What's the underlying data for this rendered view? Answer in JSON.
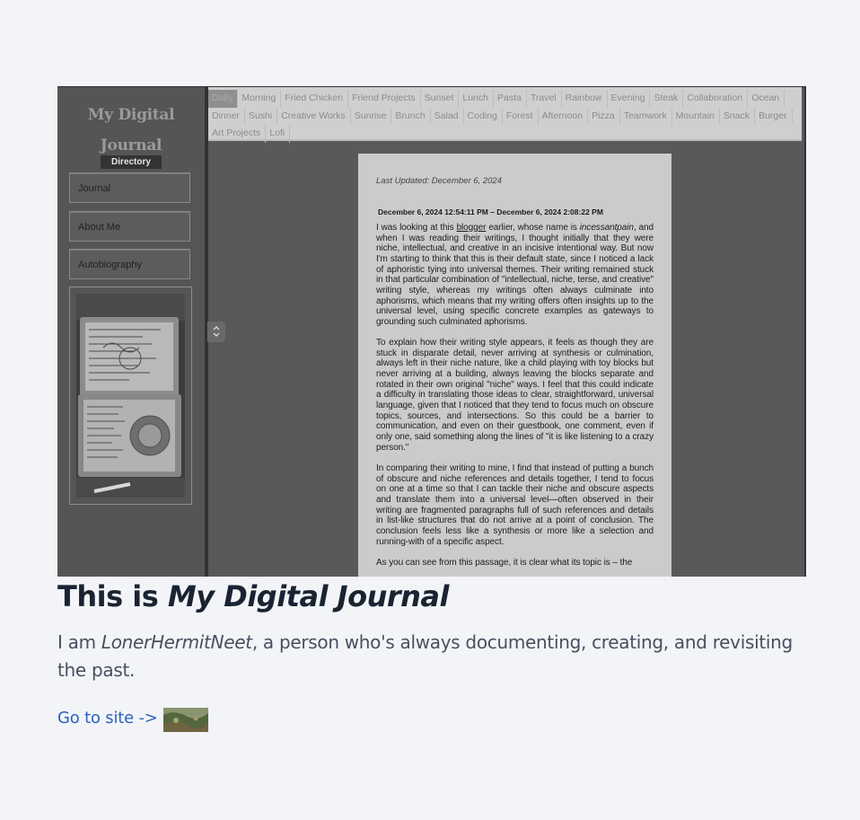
{
  "site": {
    "title_line1": "My Digital",
    "title_line2": "Journal",
    "directory_label": "Directory",
    "nav": [
      "Journal",
      "About Me",
      "Autobiography"
    ],
    "tags": [
      "Daily",
      "Morning",
      "Fried Chicken",
      "Friend Projects",
      "Sunset",
      "Lunch",
      "Pasta",
      "Travel",
      "Rainbow",
      "Evening",
      "Steak",
      "Collaboration",
      "Ocean",
      "Dinner",
      "Sushi",
      "Creative Works",
      "Sunrise",
      "Brunch",
      "Salad",
      "Coding",
      "Forest",
      "Afternoon",
      "Pizza",
      "Teamwork",
      "Mountain",
      "Snack",
      "Burger",
      "Art Projects",
      "Lofi"
    ],
    "toggle_icon": "updown-chevron-icon",
    "page": {
      "last_updated": "Last Updated: December 6, 2024",
      "date_range": "December 6, 2024 12:54:11 PM – December 6, 2024 2:08:22 PM",
      "p1_a": "I was looking at this ",
      "p1_link": "blogger",
      "p1_b": " earlier, whose name is ",
      "p1_name": "incessantpain",
      "p1_c": ", and when I was reading their writings, I thought initially that they were niche, intellectual, and creative in an incisive intentional way. But now I'm starting to think that this is their default state, since I noticed a lack of aphoristic tying into universal themes. Their writing remained stuck in that particular combination of \"intellectual, niche, terse, and creative\" writing style, whereas my writings often always culminate into aphorisms, which means that my writing offers often insights up to the universal level, using specific concrete examples as gateways to grounding such culminated aphorisms.",
      "p2": "To explain how their writing style appears, it feels as though they are stuck in disparate detail, never arriving at synthesis or culmination, always left in their niche nature, like a child playing with toy blocks but never arriving at a building, always leaving the blocks separate and rotated in their own original \"niche\" ways. I feel that this could indicate a difficulty in translating those ideas to clear, straightforward, universal language, given that I noticed that they tend to focus much on obscure topics, sources, and intersections. So this could be a barrier to communication, and even on their guestbook, one comment, even if only one, said something along the lines of \"it is like listening to a crazy person.\"",
      "p3": "In comparing their writing to mine, I find that instead of putting a bunch of obscure and niche references and details together, I tend to focus on one at a time so that I can tackle their niche and obscure aspects and translate them into a universal level—often observed in their writing are fragmented paragraphs full of such references and details in list-like structures that do not arrive at a point of conclusion. The conclusion feels less like a synthesis or more like a selection and running-with of a specific aspect.",
      "p4": "As you can see from this passage, it is clear what its topic is – the"
    }
  },
  "heading": {
    "prefix": "This is ",
    "title": "My Digital Journal"
  },
  "description": {
    "prefix": "I am ",
    "name": "LonerHermitNeet",
    "suffix": ", a person who's always documenting, creating, and revisiting the past."
  },
  "link": {
    "label": "Go to site ->"
  },
  "colors": {
    "background": "#f2f4f7",
    "heading": "#1a2332",
    "link": "#2c62c0",
    "body_text": "#475060"
  }
}
